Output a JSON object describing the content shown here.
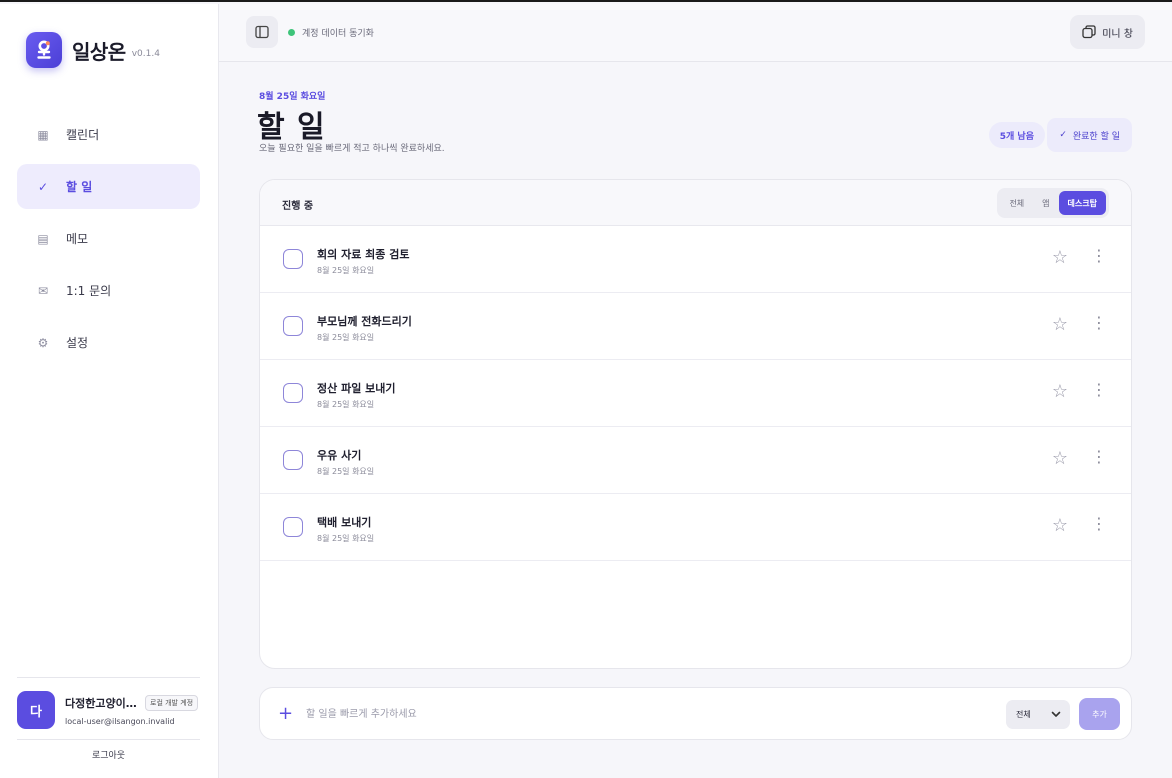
{
  "brand": {
    "name": "일상온",
    "version": "v0.1.4"
  },
  "nav": [
    {
      "icon": "▦",
      "label": "캘린더"
    },
    {
      "icon": "✓",
      "label": "할 일"
    },
    {
      "icon": "▤",
      "label": "메모"
    },
    {
      "icon": "✉",
      "label": "1:1 문의"
    },
    {
      "icon": "⚙",
      "label": "설정"
    }
  ],
  "user": {
    "avatar_initial": "다",
    "name": "다정한고양이1…",
    "badge": "로컬 개발 계정",
    "email": "local-user@ilsangon.invalid",
    "logout": "로그아웃"
  },
  "topbar": {
    "sync_status": "계정 데이터 동기화",
    "mini_window": "미니 창",
    "accent": "#5b4de0",
    "sync_color": "#3ec47a"
  },
  "page": {
    "date": "8월 25일 화요일",
    "title": "할 일",
    "subtitle": "오늘 필요한 일을 빠르게 적고 하나씩 완료하세요.",
    "remaining": "5개 남음",
    "completed_button": "완료한 할 일",
    "completed_icon": "✓"
  },
  "list": {
    "header": "진행 중",
    "filters": [
      "전체",
      "앱",
      "데스크탑"
    ],
    "tasks": [
      {
        "title": "회의 자료 최종 검토",
        "date": "8월 25일 화요일"
      },
      {
        "title": "부모님께 전화드리기",
        "date": "8월 25일 화요일"
      },
      {
        "title": "정산 파일 보내기",
        "date": "8월 25일 화요일"
      },
      {
        "title": "우유 사기",
        "date": "8월 25일 화요일"
      },
      {
        "title": "택배 보내기",
        "date": "8월 25일 화요일"
      }
    ],
    "star_icon": "☆",
    "more_icon": "⋮"
  },
  "add": {
    "plus_icon": "+",
    "placeholder": "할 일을 빠르게 추가하세요",
    "select_value": "전체",
    "submit": "추가"
  }
}
